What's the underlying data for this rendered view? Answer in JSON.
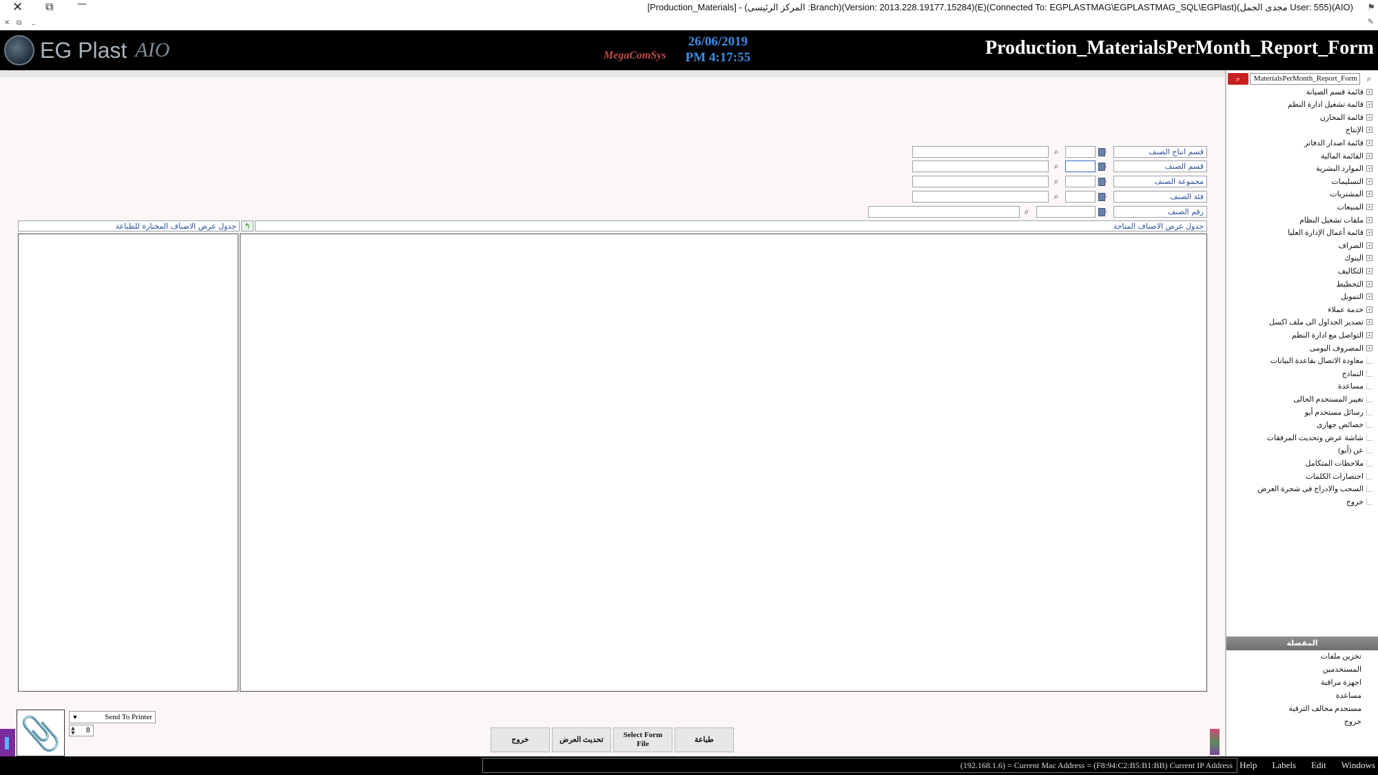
{
  "window": {
    "title": "[Production_Materials] - (المركز الرئيسى :Branch)(Version: 2013.228.19177.15284)(E)(Connected To: EGPLASTMAG\\EGPLASTMAG_SQL\\EGPlast)(مجدى الجمل User: 555)(AIO)",
    "close_glyph": "✕",
    "restore_glyph": "⧉",
    "minimize_glyph": "—",
    "mini_controls": [
      "✕",
      "⧉",
      "_"
    ]
  },
  "header": {
    "brand_name": "EG Plast",
    "brand_sub": "AIO",
    "vendor": "MegaComSys",
    "date": "26/06/2019",
    "time": "PM 4:17:55",
    "form_title": "Production_MaterialsPerMonth_Report_Form"
  },
  "filters": [
    {
      "label": "قسم انتاج الصنف"
    },
    {
      "label": "قسم الصنف"
    },
    {
      "label": "مجموعة الصنف"
    },
    {
      "label": "فئة الصنف"
    },
    {
      "label": "رقم الصنف"
    }
  ],
  "tables": {
    "available_header": "جدول عرض الاصناف المتاحة",
    "selected_header": "جدول عرض الاصناف المختارة للطباعة"
  },
  "print": {
    "destination": "Send To Printer",
    "copies": "8"
  },
  "buttons": {
    "exit": "خروج",
    "refresh": "تحديث العرض",
    "select_form_file": "Select Form File",
    "print": "طباعة"
  },
  "sidebar": {
    "search_value": "MaterialsPerMonth_Report_Form",
    "tree": [
      {
        "label": "قائمة قسم الصيانة",
        "expandable": true
      },
      {
        "label": "قائمة تشغيل ادارة النظم",
        "expandable": true
      },
      {
        "label": "قائمة المخازن",
        "expandable": true
      },
      {
        "label": "الإنتاج",
        "expandable": true
      },
      {
        "label": "قائمة اصدار الدفاتر",
        "expandable": true
      },
      {
        "label": "القائمة المالية",
        "expandable": true
      },
      {
        "label": "الموارد البشرية",
        "expandable": true
      },
      {
        "label": "التسليمات",
        "expandable": true
      },
      {
        "label": "المشتريات",
        "expandable": true
      },
      {
        "label": "المبيعات",
        "expandable": true
      },
      {
        "label": "ملفات تشغيل النظام",
        "expandable": true
      },
      {
        "label": "قائمة أعمال الإدارة العليا",
        "expandable": true
      },
      {
        "label": "الصراف",
        "expandable": true
      },
      {
        "label": "البنوك",
        "expandable": true
      },
      {
        "label": "التكاليف",
        "expandable": true
      },
      {
        "label": "التخطيط",
        "expandable": true
      },
      {
        "label": "التمويل",
        "expandable": true
      },
      {
        "label": "خدمة عملاء",
        "expandable": true
      },
      {
        "label": "تصدير الجداول الى ملف اكسل",
        "expandable": true
      },
      {
        "label": "التواصل مع ادارة النظم",
        "expandable": true
      },
      {
        "label": "المصروف اليومى",
        "expandable": true
      },
      {
        "label": "معاودة الاتصال بقاعدة البيانات",
        "expandable": false
      },
      {
        "label": "النماذج",
        "expandable": false
      },
      {
        "label": "مساعدة",
        "expandable": false
      },
      {
        "label": "تغيير المستخدم الحالى",
        "expandable": false
      },
      {
        "label": "رسائل مستخدم أيو",
        "expandable": false
      },
      {
        "label": "خصائص جهازى",
        "expandable": false
      },
      {
        "label": "شاشة عرض وتحديث المرفقات",
        "expandable": false
      },
      {
        "label": "عن (أيو)",
        "expandable": false
      },
      {
        "label": "ملاحظات المتكامل",
        "expandable": false
      },
      {
        "label": "اختصارات الكلمات",
        "expandable": false
      },
      {
        "label": "السحب والادراج فى شجرة العرض",
        "expandable": false
      },
      {
        "label": "خروج",
        "expandable": false
      }
    ],
    "favorites_title": "المفضلة",
    "favorites": [
      "تخزين ملفات",
      "المستخدمين",
      "اجهزة مراقبة",
      "مساعدة",
      "مستخدم مخالف الترقية",
      "خروج"
    ]
  },
  "statusbar": {
    "info": "(192.168.1.6) = Current Mac Address = (F8:94:C2:B5:B1:BB) Current IP Address",
    "menu": [
      "Help",
      "Labels",
      "Edit",
      "Windows"
    ]
  }
}
